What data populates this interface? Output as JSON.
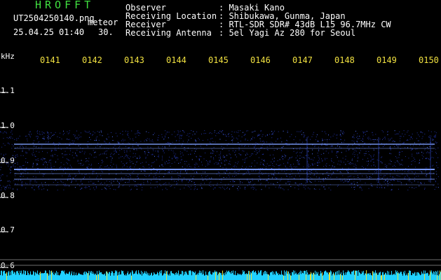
{
  "header": {
    "title": "HROFFT",
    "title_color": "#40e040",
    "filename": "UT2504250140.png",
    "kind": "meteor",
    "timestamp": "25.04.25 01:40",
    "count": "30."
  },
  "info": {
    "rows": [
      {
        "label": "Observer",
        "value": ": Masaki Kano"
      },
      {
        "label": "Receiving Location",
        "value": ": Shibukawa, Gunma, Japan"
      },
      {
        "label": "Receiver",
        "value": ": RTL-SDR SDR# 43dB L15 96.7MHz CW"
      },
      {
        "label": "Receiving Antenna",
        "value": ": 5el Yagi Az 280 for Seoul"
      }
    ]
  },
  "axis": {
    "unit": "kHz",
    "time_ticks": [
      "0141",
      "0142",
      "0143",
      "0144",
      "0145",
      "0146",
      "0147",
      "0148",
      "0149",
      "0150"
    ],
    "freq_ticks": [
      "1.1",
      "1.0",
      "0.9",
      "0.8",
      "0.7",
      "0.6"
    ]
  },
  "colors": {
    "background": "#000000",
    "signal": "#4060ff",
    "carrier": "#80a0ff",
    "noise_floor": "#20d0ff",
    "tick_text": "#f0e040"
  }
}
